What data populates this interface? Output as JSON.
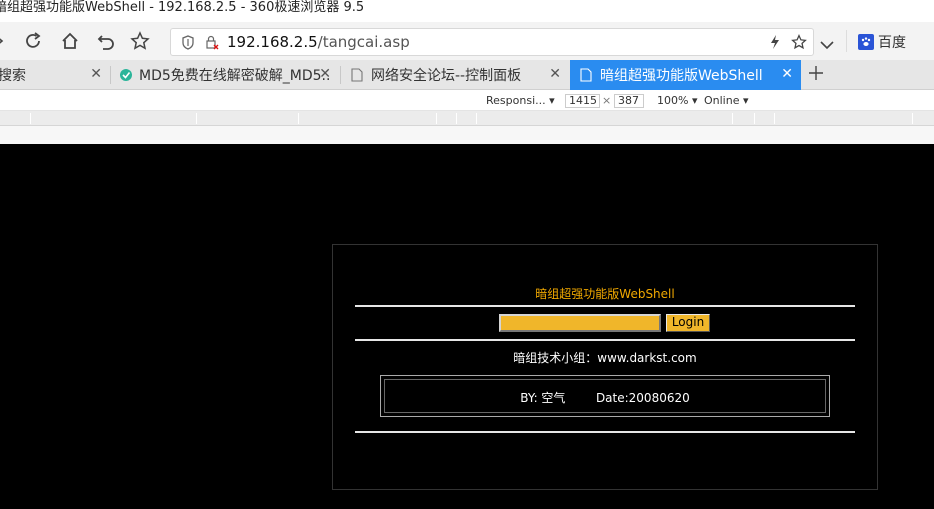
{
  "window": {
    "title": "暗组超强功能版WebShell - 192.168.2.5 - 360极速浏览器 9.5"
  },
  "navbar": {
    "url_host": "192.168.2.5",
    "url_path": "/tangcai.asp",
    "search_engine": "百度"
  },
  "tabs": [
    {
      "label": "搜索",
      "active": false
    },
    {
      "label": "MD5免费在线解密破解_MD5...",
      "active": false
    },
    {
      "label": "网络安全论坛--控制面板",
      "active": false
    },
    {
      "label": "暗组超强功能版WebShell",
      "active": true
    }
  ],
  "devtools": {
    "device": "Responsi...",
    "width": "1415",
    "times": "×",
    "height": "387",
    "zoom": "100%",
    "network": "Online"
  },
  "page": {
    "title": "暗组超强功能版WebShell",
    "password_value": "",
    "login_label": "Login",
    "team": "暗组技术小组：www.darkst.com",
    "by_label": "BY: 空气",
    "date_label": "Date:20080620"
  },
  "colors": {
    "tab_active": "#2a8cf0",
    "title_orange": "#f2a900",
    "input_fill": "#f0b62a",
    "page_bg": "#000000"
  }
}
